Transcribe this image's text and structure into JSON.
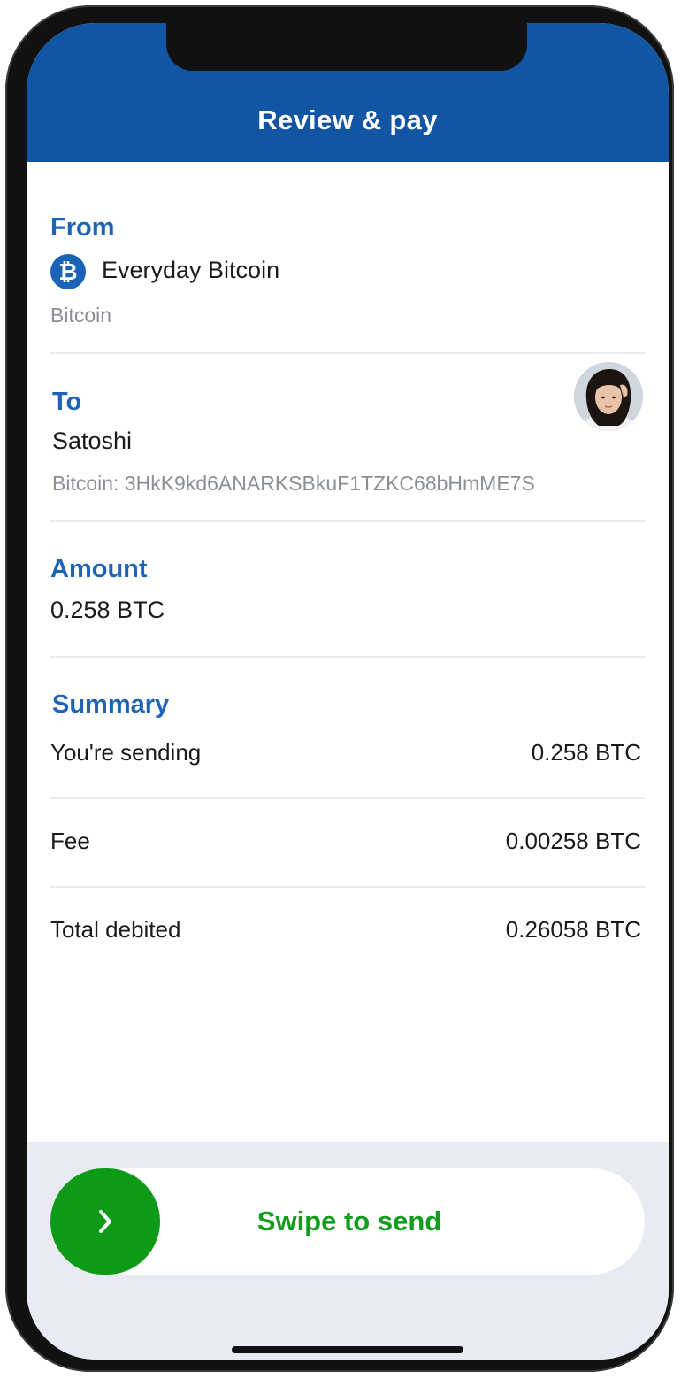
{
  "header": {
    "title": "Review & pay"
  },
  "from": {
    "label": "From",
    "account_name": "Everyday Bitcoin",
    "account_type": "Bitcoin",
    "icon": "bitcoin-icon",
    "icon_glyph": "₿"
  },
  "to": {
    "label": "To",
    "recipient_name": "Satoshi",
    "address_line": "Bitcoin: 3HkK9kd6ANARKSBkuF1TZKC68bHmME7S",
    "avatar": "recipient-avatar"
  },
  "amount": {
    "label": "Amount",
    "value": "0.258 BTC"
  },
  "summary": {
    "label": "Summary",
    "rows": [
      {
        "label": "You're sending",
        "value": "0.258 BTC"
      },
      {
        "label": "Fee",
        "value": "0.00258 BTC"
      },
      {
        "label": "Total debited",
        "value": "0.26058 BTC"
      }
    ]
  },
  "swipe": {
    "label": "Swipe to send",
    "knob_icon": "chevron-right-icon",
    "knob_glyph": "›"
  },
  "colors": {
    "header_blue": "#1255a3",
    "label_blue": "#1e64b4",
    "action_green": "#0c9a17",
    "footer_bg": "#e8ebf4"
  }
}
